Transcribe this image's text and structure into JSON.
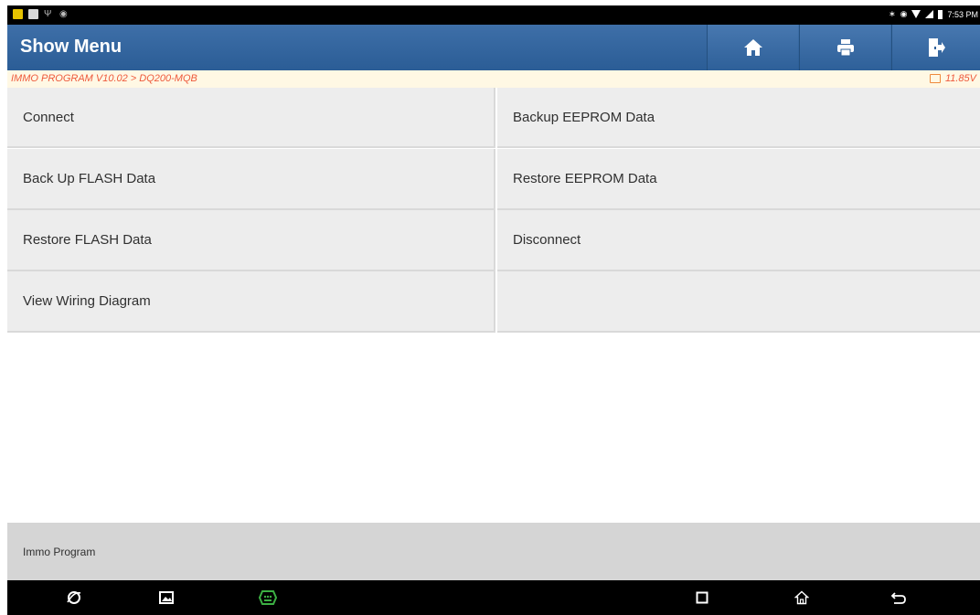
{
  "status_bar": {
    "time": "7:53 PM"
  },
  "header": {
    "title": "Show Menu",
    "home_icon": "home-icon",
    "print_icon": "print-icon",
    "exit_icon": "exit-icon"
  },
  "breadcrumb": {
    "path": "IMMO PROGRAM V10.02 > DQ200-MQB",
    "voltage": "11.85V"
  },
  "menu": {
    "items": [
      {
        "label": "Connect"
      },
      {
        "label": "Backup EEPROM Data"
      },
      {
        "label": "Back Up FLASH Data"
      },
      {
        "label": "Restore EEPROM Data"
      },
      {
        "label": "Restore FLASH Data"
      },
      {
        "label": "Disconnect"
      },
      {
        "label": "View Wiring Diagram"
      },
      {
        "label": ""
      }
    ]
  },
  "footer": {
    "text": "Immo Program"
  },
  "colors": {
    "header_blue": "#2b5d96",
    "breadcrumb_orange": "#ee5a3c",
    "vci_green": "#3cb043"
  }
}
